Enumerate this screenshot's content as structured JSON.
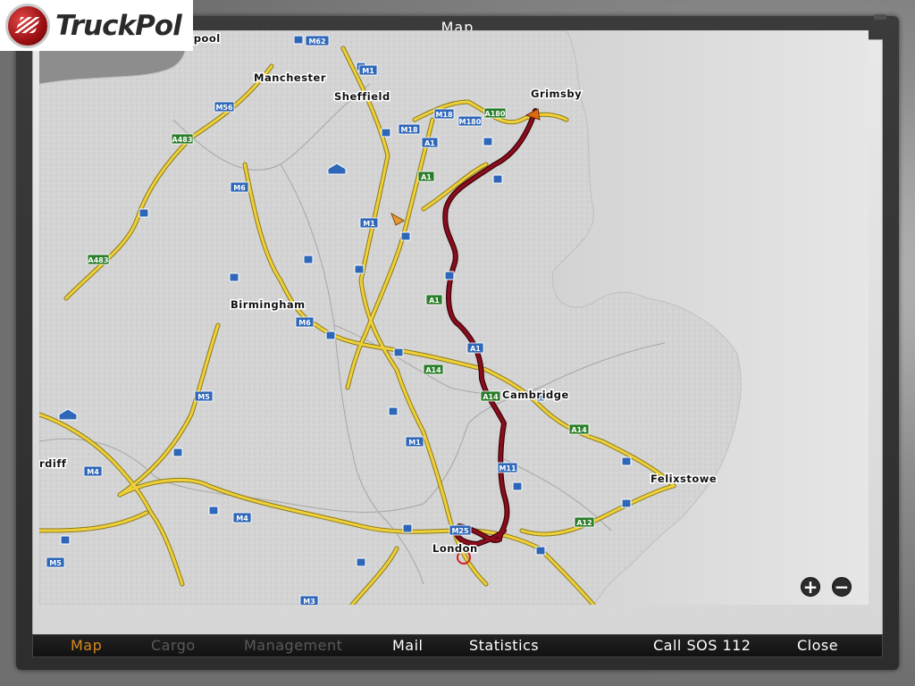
{
  "logo": {
    "text": "TruckPol"
  },
  "window": {
    "title": "Map"
  },
  "map": {
    "cities": {
      "liverpool": "Liverpool",
      "manchester": "Manchester",
      "sheffield": "Sheffield",
      "grimsby": "Grimsby",
      "birmingham": "Birmingham",
      "cambridge": "Cambridge",
      "felixstowe": "Felixstowe",
      "london": "London",
      "cardiff_partial": "rdiff"
    },
    "roads": {
      "m62": "M62",
      "m1_north": "M1",
      "m18_a": "M18",
      "m180": "M180",
      "a180": "A180",
      "m18_b": "M18",
      "a1_a": "A1",
      "a1_b": "A1",
      "m56": "M56",
      "a483_a": "A483",
      "m6_a": "M6",
      "m1_mid": "M1",
      "a483_b": "A483",
      "a1_c": "A1",
      "m6_b": "M6",
      "a1_d": "A1",
      "a14_a": "A14",
      "a14_b": "A14",
      "m5_a": "M5",
      "m1_south": "M1",
      "a14_c": "A14",
      "m11": "M11",
      "m4_a": "M4",
      "m4_b": "M4",
      "a12": "A12",
      "m25": "M25",
      "m5_b": "M5",
      "m3": "M3"
    },
    "zoom_in_symbol": "+",
    "zoom_out_symbol": "−"
  },
  "menu": {
    "map": "Map",
    "cargo": "Cargo",
    "management": "Management",
    "mail": "Mail",
    "statistics": "Statistics",
    "call_sos": "Call SOS 112",
    "close": "Close"
  },
  "colors": {
    "route": "#8b0d1e",
    "motorway": "#efd03a",
    "land": "#d2d2d2",
    "sea": "#a9a9a9",
    "active_menu": "#d98a1e",
    "disabled_menu": "#5a5a5a"
  }
}
